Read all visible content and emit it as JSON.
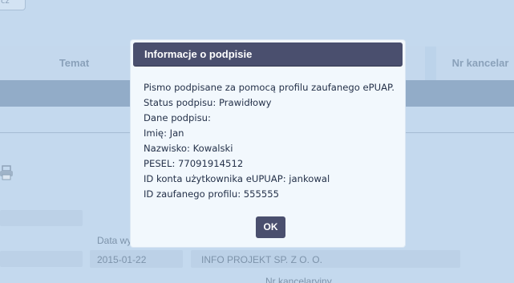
{
  "background": {
    "top_button_label": "cz",
    "table_headers": {
      "temat": "Temat",
      "nr_kancelaryjny": "Nr kancelar"
    },
    "date_label": "Data wy",
    "date_value": "2015-01-22",
    "company_value": "INFO PROJEKT SP. Z O. O.",
    "nr_kancelaryjny_label": "Nr kancelaryjny",
    "print_icon": "printer-icon"
  },
  "dialog": {
    "title": "Informacje o podpisie",
    "lines": [
      "Pismo podpisane za pomocą profilu zaufanego ePUAP.",
      "Status podpisu: Prawidłowy",
      "Dane podpisu:",
      "Imię: Jan",
      "Nazwisko: Kowalski",
      "PESEL: 77091914512",
      "ID konta użytkownika eUPUAP: jankowal",
      "ID zaufanego profilu: 555555"
    ],
    "ok_label": "OK"
  },
  "colors": {
    "overlay_bg": "#c4d9ee",
    "dialog_header": "#4a4f6e",
    "dialog_bg": "#f2f8fd",
    "band": "#92acc8"
  }
}
